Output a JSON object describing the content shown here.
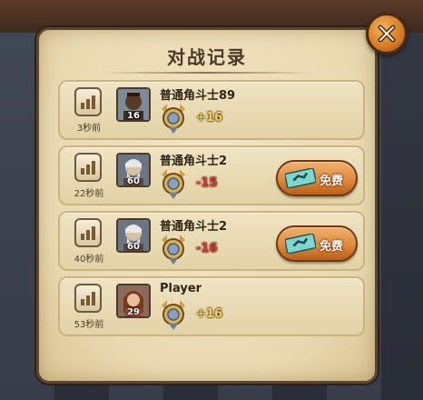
{
  "dialog": {
    "title": "对战记录",
    "close_icon": "close-x-icon"
  },
  "records": [
    {
      "time": "3秒前",
      "name": "普通角斗士89",
      "level": "16",
      "score": "+16",
      "score_color": "#ffd24a",
      "avatar": "dark-fighter",
      "free_button": null
    },
    {
      "time": "22秒前",
      "name": "普通角斗士2",
      "level": "60",
      "score": "-15",
      "score_color": "#e8352a",
      "avatar": "old-master",
      "free_button": "免费"
    },
    {
      "time": "40秒前",
      "name": "普通角斗士2",
      "level": "60",
      "score": "-16",
      "score_color": "#e8352a",
      "avatar": "old-master",
      "free_button": "免费"
    },
    {
      "time": "53秒前",
      "name": "Player",
      "level": "29",
      "score": "+16",
      "score_color": "#ffd24a",
      "avatar": "woman-fighter",
      "free_button": null
    }
  ],
  "colors": {
    "panel_bg": "#ecdcb4",
    "gain": "#ffd24a",
    "loss": "#e8352a",
    "button": "#e08a3a"
  }
}
